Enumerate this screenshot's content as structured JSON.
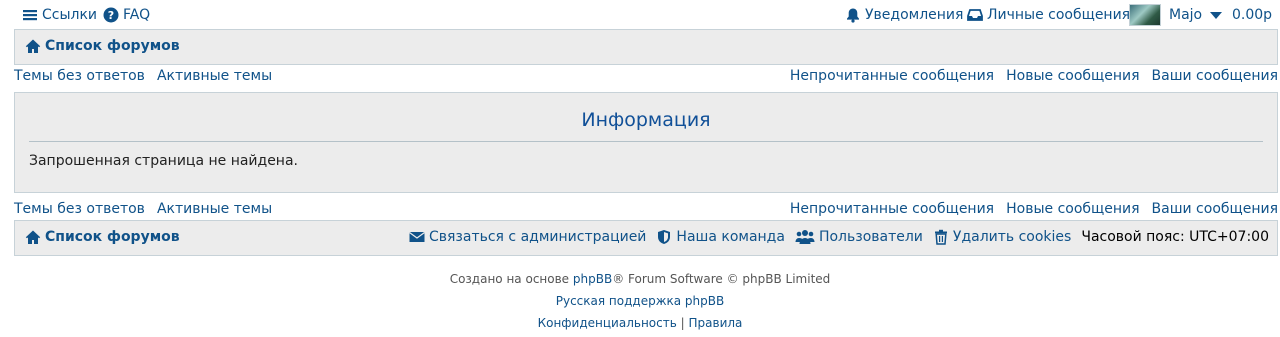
{
  "topbar": {
    "links_label": "Ссылки",
    "faq_label": "FAQ",
    "notifications_label": "Уведомления",
    "messages_label": "Личные сообщения",
    "username": "Majo",
    "balance": "0.00р"
  },
  "breadcrumb": {
    "home_label": "Список форумов"
  },
  "quicklinks": {
    "unanswered": "Темы без ответов",
    "active": "Активные темы",
    "unread": "Непрочитанные сообщения",
    "new_posts": "Новые сообщения",
    "your_posts": "Ваши сообщения"
  },
  "info_panel": {
    "title": "Информация",
    "message": "Запрошенная страница не найдена."
  },
  "footer_nav": {
    "home_label": "Список форумов",
    "contact_label": "Связаться с администрацией",
    "team_label": "Наша команда",
    "members_label": "Пользователи",
    "cookies_label": "Удалить cookies",
    "timezone_label": "Часовой пояс:",
    "timezone_value": "UTC+07:00"
  },
  "copyright": {
    "prefix": "Создано на основе",
    "phpbb_link": "phpBB",
    "suffix": "® Forum Software © phpBB Limited",
    "support_link": "Русская поддержка phpBB",
    "privacy_link": "Конфиденциальность",
    "separator": "|",
    "terms_link": "Правила"
  },
  "colors": {
    "link": "#105289",
    "panel_bg": "#ececec",
    "panel_border": "#c7d2d8",
    "heading": "#115098"
  }
}
